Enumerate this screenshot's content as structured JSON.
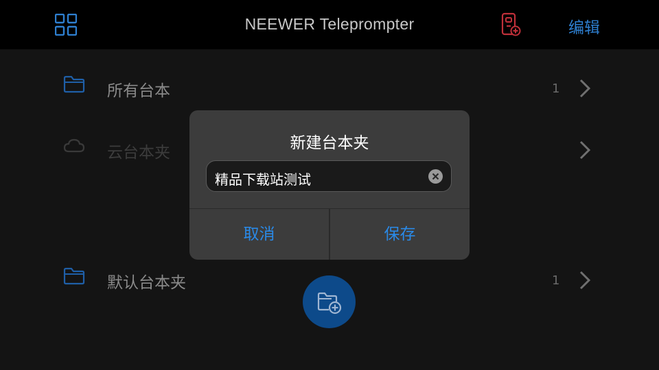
{
  "header": {
    "title": "NEEWER Teleprompter",
    "edit_label": "编辑",
    "accent": "#2e7fd0",
    "device_icon_color": "#c0303a"
  },
  "folders": [
    {
      "label": "所有台本",
      "count": "1",
      "icon": "folder-icon"
    },
    {
      "label": "云台本夹",
      "count": "",
      "icon": "cloud-icon"
    },
    {
      "label": "默认台本夹",
      "count": "1",
      "icon": "folder-icon"
    }
  ],
  "dialog": {
    "title": "新建台本夹",
    "input_value": "精品下载站测试",
    "cancel_label": "取消",
    "save_label": "保存",
    "button_color": "#2a8ae8"
  },
  "fab": {
    "icon": "add-folder-icon",
    "color": "#0d4a8a"
  }
}
